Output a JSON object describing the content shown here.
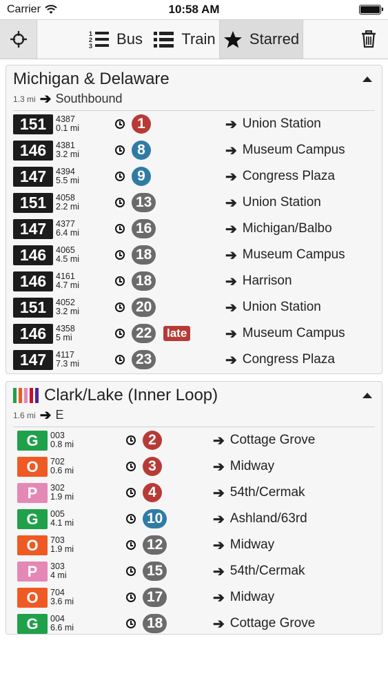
{
  "status_bar": {
    "carrier": "Carrier",
    "time": "10:58 AM"
  },
  "toolbar": {
    "bus_label": "Bus",
    "train_label": "Train",
    "starred_label": "Starred"
  },
  "colors": {
    "eta_red": "#b83a36",
    "eta_blue": "#2f7ba6",
    "eta_gray": "#6b6b6b",
    "route_black": "#1c1c1c",
    "line_green": "#1fa14a",
    "line_orange": "#ef5a24",
    "line_pink": "#e488b5",
    "line_red": "#c8102e",
    "line_purple": "#522398"
  },
  "bus_stop": {
    "title": "Michigan & Delaware",
    "distance": "1.3 mi",
    "direction": "Southbound",
    "arrivals": [
      {
        "route": "151",
        "vehicle": "4387",
        "distance": "0.1 mi",
        "eta": "1",
        "eta_color": "red",
        "late": "",
        "destination": "Union Station"
      },
      {
        "route": "146",
        "vehicle": "4381",
        "distance": "3.2 mi",
        "eta": "8",
        "eta_color": "blue",
        "late": "",
        "destination": "Museum Campus"
      },
      {
        "route": "147",
        "vehicle": "4394",
        "distance": "5.5 mi",
        "eta": "9",
        "eta_color": "blue",
        "late": "",
        "destination": "Congress Plaza"
      },
      {
        "route": "151",
        "vehicle": "4058",
        "distance": "2.2 mi",
        "eta": "13",
        "eta_color": "gray",
        "late": "",
        "destination": "Union Station"
      },
      {
        "route": "147",
        "vehicle": "4377",
        "distance": "6.4 mi",
        "eta": "16",
        "eta_color": "gray",
        "late": "",
        "destination": "Michigan/Balbo"
      },
      {
        "route": "146",
        "vehicle": "4065",
        "distance": "4.5 mi",
        "eta": "18",
        "eta_color": "gray",
        "late": "",
        "destination": "Museum Campus"
      },
      {
        "route": "146",
        "vehicle": "4161",
        "distance": "4.7 mi",
        "eta": "18",
        "eta_color": "gray",
        "late": "",
        "destination": "Harrison"
      },
      {
        "route": "151",
        "vehicle": "4052",
        "distance": "3.2 mi",
        "eta": "20",
        "eta_color": "gray",
        "late": "",
        "destination": "Union Station"
      },
      {
        "route": "146",
        "vehicle": "4358",
        "distance": "5 mi",
        "eta": "22",
        "eta_color": "gray",
        "late": "late",
        "destination": "Museum Campus"
      },
      {
        "route": "147",
        "vehicle": "4117",
        "distance": "7.3 mi",
        "eta": "23",
        "eta_color": "gray",
        "late": "",
        "destination": "Congress Plaza"
      }
    ]
  },
  "train_stop": {
    "title": "Clark/Lake (Inner Loop)",
    "distance": "1.6 mi",
    "direction": "E",
    "line_stripes": [
      "green",
      "orange",
      "pink",
      "red",
      "purple"
    ],
    "arrivals": [
      {
        "line": "G",
        "line_color": "green",
        "run": "003",
        "distance": "0.8 mi",
        "eta": "2",
        "eta_color": "red",
        "destination": "Cottage Grove"
      },
      {
        "line": "O",
        "line_color": "orange",
        "run": "702",
        "distance": "0.6 mi",
        "eta": "3",
        "eta_color": "red",
        "destination": "Midway"
      },
      {
        "line": "P",
        "line_color": "pink",
        "run": "302",
        "distance": "1.9 mi",
        "eta": "4",
        "eta_color": "red",
        "destination": "54th/Cermak"
      },
      {
        "line": "G",
        "line_color": "green",
        "run": "005",
        "distance": "4.1 mi",
        "eta": "10",
        "eta_color": "blue",
        "destination": "Ashland/63rd"
      },
      {
        "line": "O",
        "line_color": "orange",
        "run": "703",
        "distance": "1.9 mi",
        "eta": "12",
        "eta_color": "gray",
        "destination": "Midway"
      },
      {
        "line": "P",
        "line_color": "pink",
        "run": "303",
        "distance": "4 mi",
        "eta": "15",
        "eta_color": "gray",
        "destination": "54th/Cermak"
      },
      {
        "line": "O",
        "line_color": "orange",
        "run": "704",
        "distance": "3.6 mi",
        "eta": "17",
        "eta_color": "gray",
        "destination": "Midway"
      },
      {
        "line": "G",
        "line_color": "green",
        "run": "004",
        "distance": "6.6 mi",
        "eta": "18",
        "eta_color": "gray",
        "destination": "Cottage Grove"
      }
    ]
  }
}
